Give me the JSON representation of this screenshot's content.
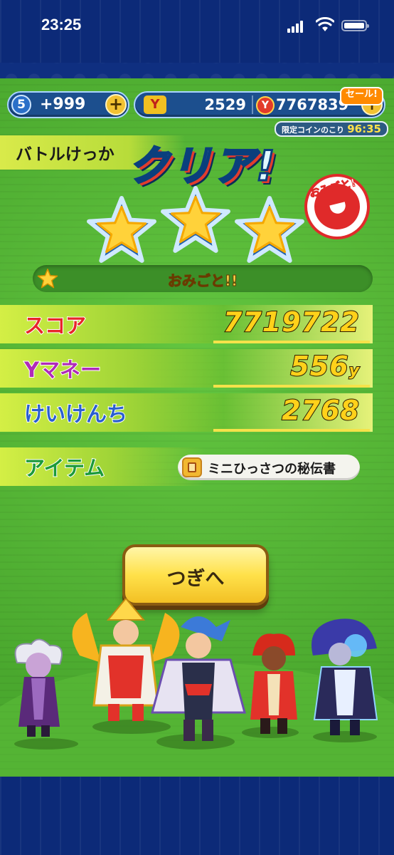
{
  "status_bar": {
    "time": "23:25"
  },
  "topbar": {
    "level": "5",
    "stamina": "+999",
    "plus": "+",
    "yen_icon": "Y",
    "money": "2529",
    "coins": "7767839",
    "sale_label": "セール!",
    "limited_coin_label": "限定コインのこり",
    "limited_coin_time": "96:35"
  },
  "result": {
    "heading": "バトルけっか",
    "title": "クリア!",
    "stars_earned": 3,
    "stars_total": 3,
    "stamp_text": "おみごと!",
    "praise": "おみごと!!"
  },
  "rows": {
    "score_label": "スコア",
    "score_value": "7719722",
    "money_label": "Yマネー",
    "money_value": "556",
    "money_unit": "y",
    "exp_label": "けいけんち",
    "exp_value": "2768",
    "item_label": "アイテム",
    "item_name": "ミニひっさつの秘伝書"
  },
  "next_button": {
    "label": "つぎへ"
  },
  "colors": {
    "game_green": "#52b636",
    "frame_blue": "#0c2a78",
    "value_yellow": "#ffd11a",
    "button_yellow": "#ffe14a"
  },
  "icons": [
    "signal-icon",
    "wifi-icon",
    "battery-icon",
    "star-icon",
    "book-icon",
    "coin-icon",
    "yen-icon",
    "plus-icon"
  ]
}
